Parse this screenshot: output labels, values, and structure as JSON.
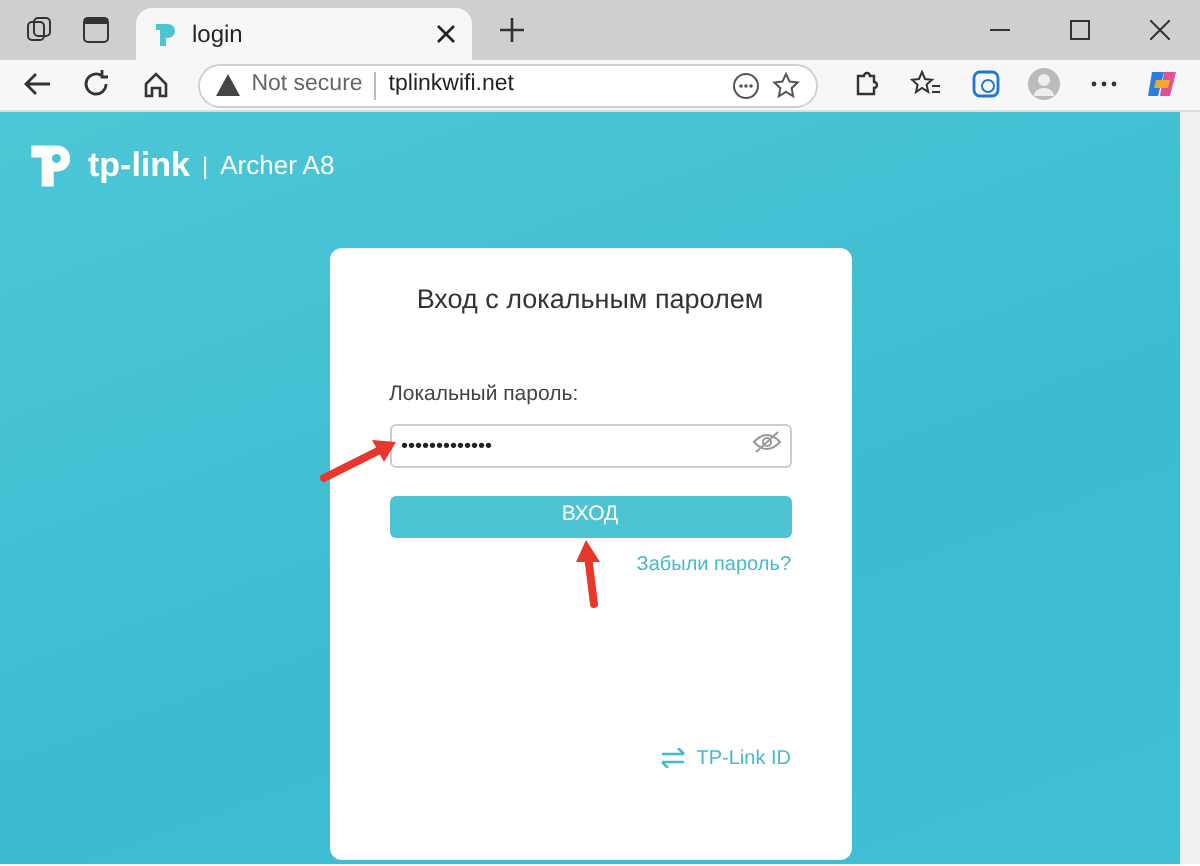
{
  "browser": {
    "tab": {
      "title": "login",
      "selected": true
    },
    "address": {
      "security": "Not secure",
      "url": "tplinkwifi.net"
    }
  },
  "header": {
    "brand": "tp-link",
    "separator": "|",
    "model": "Archer A8"
  },
  "login": {
    "title": "Вход с локальным паролем",
    "password_label": "Локальный пароль:",
    "password_value": "•••••••••••••",
    "button": "ВХОД",
    "forgot_link": "Забыли пароль?",
    "id_link": "TP-Link ID"
  }
}
